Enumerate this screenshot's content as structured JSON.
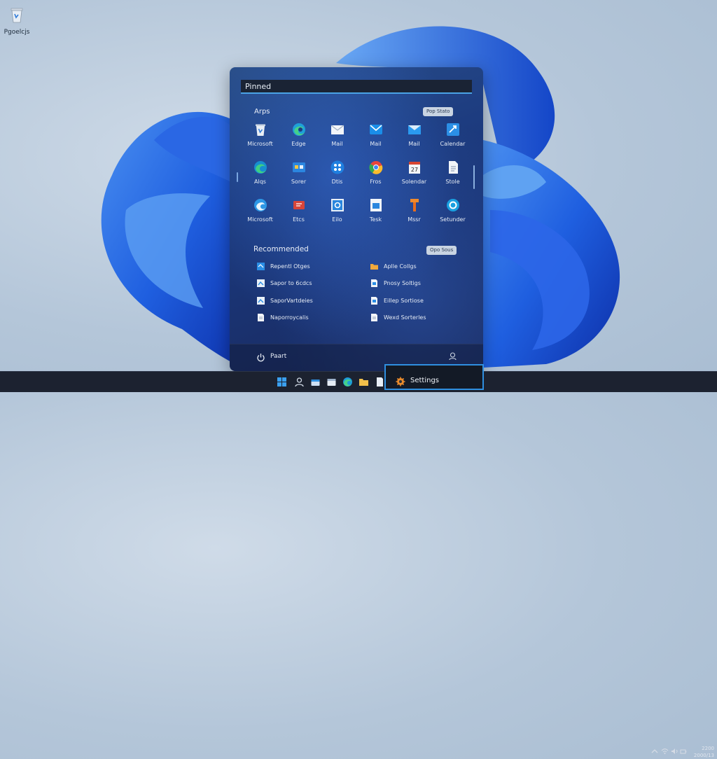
{
  "desktop": {
    "recycle_bin_label": "Pgoelcjs"
  },
  "start_menu": {
    "search_text": "Pinned",
    "apps_section_title": "Arps",
    "apps_section_button": "Pop Stato",
    "pinned_apps": [
      {
        "label": "Microsoft",
        "icon": "recycle-bin-icon"
      },
      {
        "label": "Edge",
        "icon": "edge-icon"
      },
      {
        "label": "Mail",
        "icon": "mail-icon"
      },
      {
        "label": "Mail",
        "icon": "mail-icon"
      },
      {
        "label": "Mail",
        "icon": "mail-icon"
      },
      {
        "label": "Calendar",
        "icon": "calendar-icon"
      },
      {
        "label": "Alqs",
        "icon": "edge-icon"
      },
      {
        "label": "Sorer",
        "icon": "store-icon"
      },
      {
        "label": "Dtis",
        "icon": "apps-icon"
      },
      {
        "label": "Fros",
        "icon": "chrome-icon"
      },
      {
        "label": "Solendar",
        "icon": "calendar-icon"
      },
      {
        "label": "Stole",
        "icon": "document-icon"
      },
      {
        "label": "Microsoft",
        "icon": "edge-icon"
      },
      {
        "label": "Etcs",
        "icon": "mail-red-icon"
      },
      {
        "label": "Eilo",
        "icon": "settings-blue-icon"
      },
      {
        "label": "Tesk",
        "icon": "task-icon"
      },
      {
        "label": "Mssr",
        "icon": "tool-icon"
      },
      {
        "label": "Setunder",
        "icon": "circle-icon"
      }
    ],
    "recommended_title": "Recommended",
    "recommended_button": "Opo Sous",
    "recommended": [
      {
        "label": "Repentl Otges",
        "icon": "doc-blue-icon"
      },
      {
        "label": "Sapor to 6cdcs",
        "icon": "doc-blue-icon"
      },
      {
        "label": "SaporVartdeies",
        "icon": "doc-blue-icon"
      },
      {
        "label": "Naporroycalis",
        "icon": "doc-white-icon"
      },
      {
        "label": "Aplle Collgs",
        "icon": "folder-icon"
      },
      {
        "label": "Pnosy Soltigs",
        "icon": "doc-white-icon"
      },
      {
        "label": "Eillep Sortiose",
        "icon": "doc-white-icon"
      },
      {
        "label": "Wexd Sorterles",
        "icon": "doc-white-icon"
      }
    ],
    "user_name": "Paart"
  },
  "taskbar": {
    "highlight_label": "Settings",
    "clock_time": "2200",
    "clock_date": "2000/13",
    "accent": "#2f8fe0"
  }
}
